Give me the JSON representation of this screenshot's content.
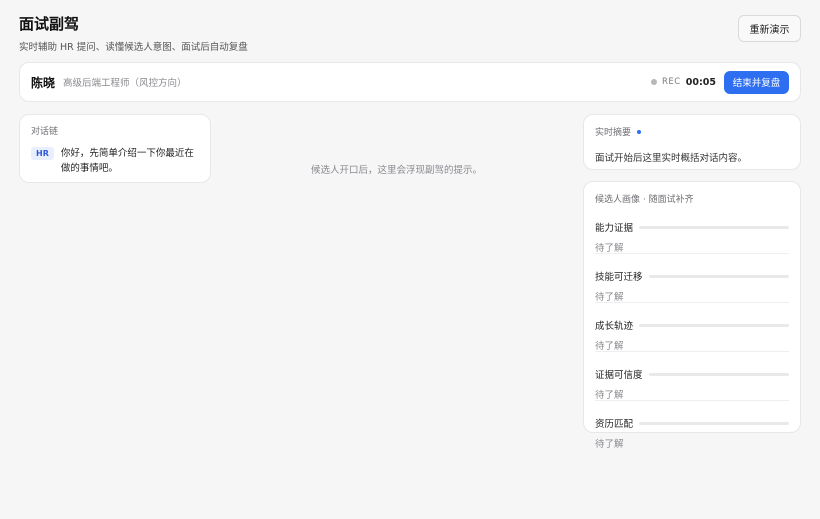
{
  "header": {
    "title": "面试副驾",
    "subtitle": "实时辅助 HR 提问、读懂候选人意图、面试后自动复盘",
    "replay_label": "重新演示"
  },
  "session": {
    "candidate_name": "陈晓",
    "candidate_role": "高级后端工程师（风控方向）",
    "rec_label": "REC",
    "elapsed": "00:05",
    "end_label": "结束并复盘"
  },
  "conversation": {
    "label": "对话链",
    "messages": [
      {
        "speaker": "HR",
        "text": "你好，先简单介绍一下你最近在做的事情吧。"
      }
    ]
  },
  "hint": "候选人开口后，这里会浮现副驾的提示。",
  "summary": {
    "label": "实时摘要",
    "text": "面试开始后这里实时概括对话内容。"
  },
  "profile": {
    "label": "候选人画像 · 随面试补齐",
    "dimensions": [
      {
        "name": "能力证据",
        "status": "待了解",
        "progress": 0
      },
      {
        "name": "技能可迁移",
        "status": "待了解",
        "progress": 0
      },
      {
        "name": "成长轨迹",
        "status": "待了解",
        "progress": 0
      },
      {
        "name": "证据可信度",
        "status": "待了解",
        "progress": 0
      },
      {
        "name": "资历匹配",
        "status": "待了解",
        "progress": 0
      }
    ]
  },
  "colors": {
    "accent": "#2e6ef0",
    "background": "#f6f6f7",
    "card": "#ffffff"
  }
}
